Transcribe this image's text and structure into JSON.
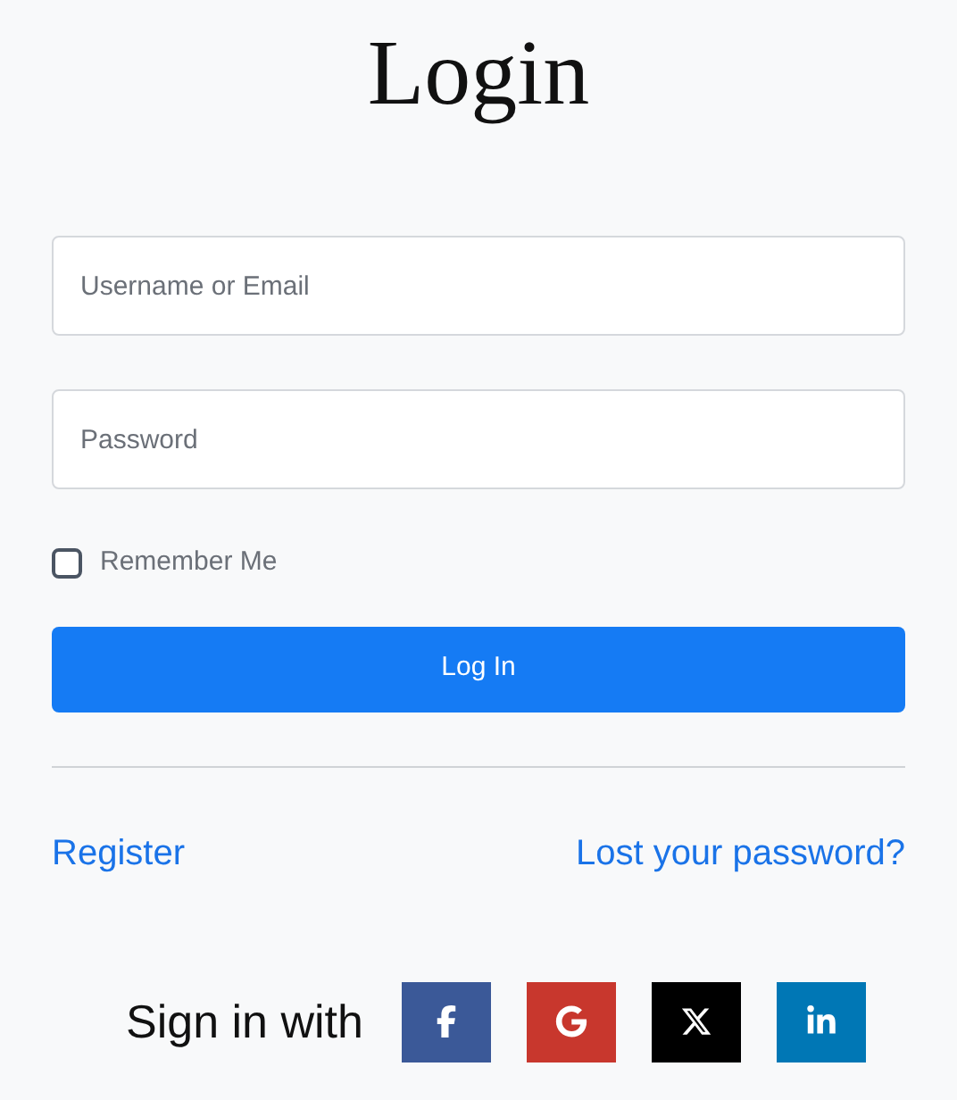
{
  "title": "Login",
  "fields": [
    {
      "placeholder": "Username or Email"
    },
    {
      "placeholder": "Password"
    }
  ],
  "remember": {
    "label": "Remember Me",
    "checked": false
  },
  "submit": "Log In",
  "links": [
    "Register",
    "Lost your password?"
  ],
  "social": {
    "label": "Sign in with",
    "buttons": [
      {
        "kind": "facebook",
        "color": "#3b5998"
      },
      {
        "kind": "google",
        "color": "#c8372d"
      },
      {
        "kind": "x",
        "color": "#000000"
      },
      {
        "kind": "linkedin",
        "color": "#0077b5"
      }
    ]
  }
}
